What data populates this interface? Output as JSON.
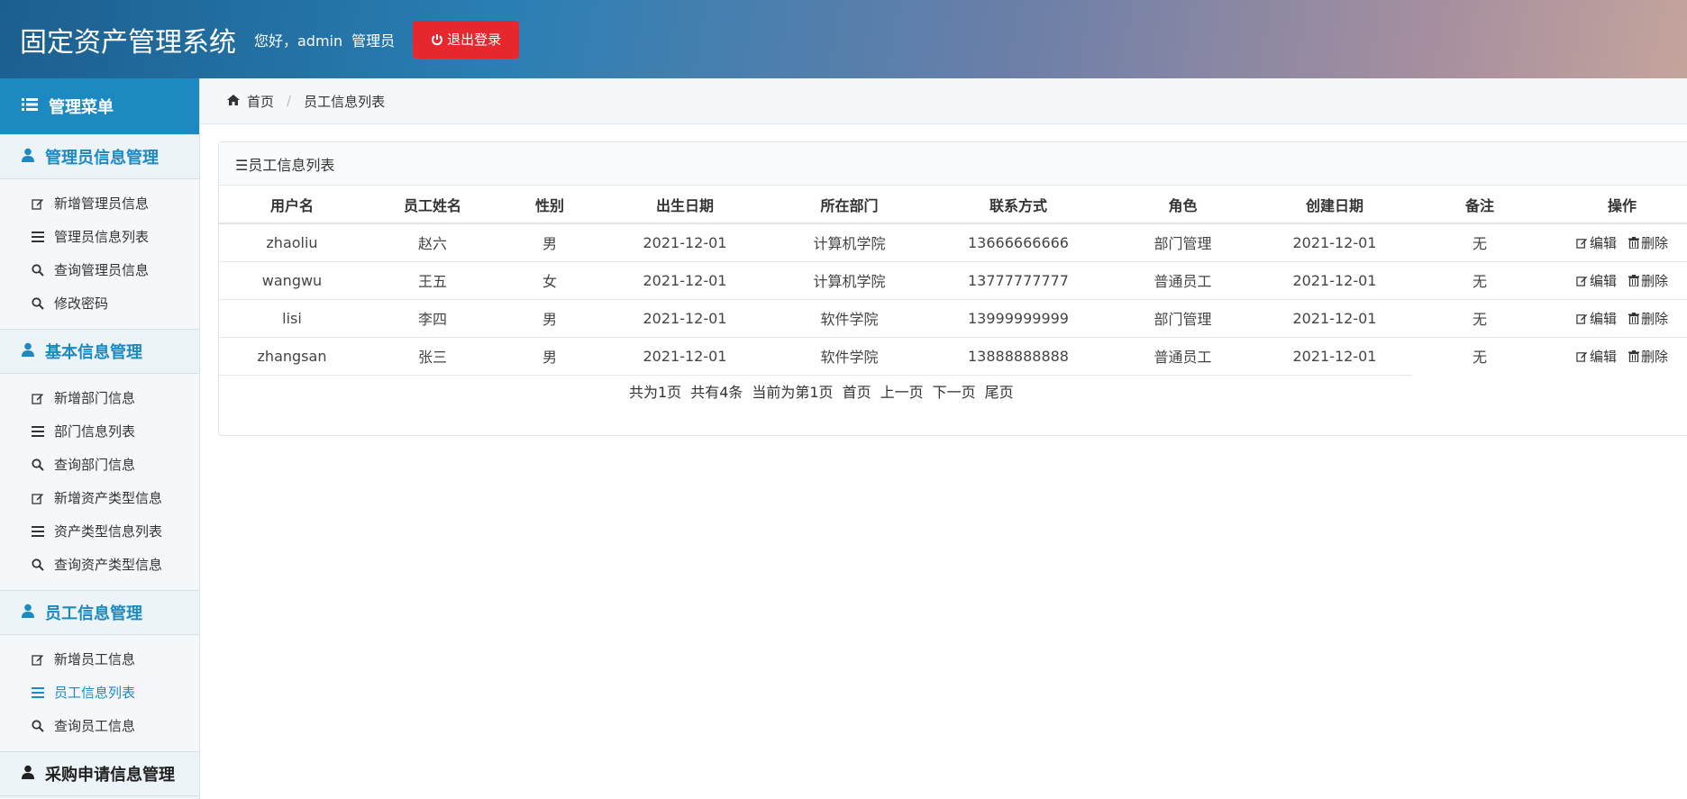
{
  "header": {
    "app_title": "固定资产管理系统",
    "greeting": "您好，admin",
    "role": "管理员",
    "logout_label": "退出登录",
    "logout_color": "#e6282e"
  },
  "sidebar": {
    "menu_title": "管理菜单",
    "groups": [
      {
        "title": "管理员信息管理",
        "items": [
          {
            "label": "新增管理员信息",
            "icon": "edit-icon"
          },
          {
            "label": "管理员信息列表",
            "icon": "list-icon"
          },
          {
            "label": "查询管理员信息",
            "icon": "search-icon"
          },
          {
            "label": "修改密码",
            "icon": "search-icon"
          }
        ]
      },
      {
        "title": "基本信息管理",
        "items": [
          {
            "label": "新增部门信息",
            "icon": "edit-icon"
          },
          {
            "label": "部门信息列表",
            "icon": "list-icon"
          },
          {
            "label": "查询部门信息",
            "icon": "search-icon"
          },
          {
            "label": "新增资产类型信息",
            "icon": "edit-icon"
          },
          {
            "label": "资产类型信息列表",
            "icon": "list-icon"
          },
          {
            "label": "查询资产类型信息",
            "icon": "search-icon"
          }
        ]
      },
      {
        "title": "员工信息管理",
        "items": [
          {
            "label": "新增员工信息",
            "icon": "edit-icon"
          },
          {
            "label": "员工信息列表",
            "icon": "list-icon",
            "active": true
          },
          {
            "label": "查询员工信息",
            "icon": "search-icon"
          }
        ]
      },
      {
        "title": "采购申请信息管理",
        "items": []
      }
    ],
    "accent_color": "#1c8ac0"
  },
  "breadcrumb": {
    "home": "首页",
    "current": "员工信息列表"
  },
  "panel": {
    "title": "☰员工信息列表"
  },
  "table": {
    "headers": [
      "用户名",
      "员工姓名",
      "性别",
      "出生日期",
      "所在部门",
      "联系方式",
      "角色",
      "创建日期",
      "备注",
      "操作"
    ],
    "rows": [
      [
        "zhaoliu",
        "赵六",
        "男",
        "2021-12-01",
        "计算机学院",
        "13666666666",
        "部门管理",
        "2021-12-01",
        "无"
      ],
      [
        "wangwu",
        "王五",
        "女",
        "2021-12-01",
        "计算机学院",
        "13777777777",
        "普通员工",
        "2021-12-01",
        "无"
      ],
      [
        "lisi",
        "李四",
        "男",
        "2021-12-01",
        "软件学院",
        "13999999999",
        "部门管理",
        "2021-12-01",
        "无"
      ],
      [
        "zhangsan",
        "张三",
        "男",
        "2021-12-01",
        "软件学院",
        "13888888888",
        "普通员工",
        "2021-12-01",
        "无"
      ]
    ],
    "edit_label": "编辑",
    "delete_label": "删除"
  },
  "pager": {
    "total_pages": "共为1页",
    "total_items": "共有4条",
    "current_page": "当前为第1页",
    "first": "首页",
    "prev": "上一页",
    "next": "下一页",
    "last": "尾页"
  }
}
